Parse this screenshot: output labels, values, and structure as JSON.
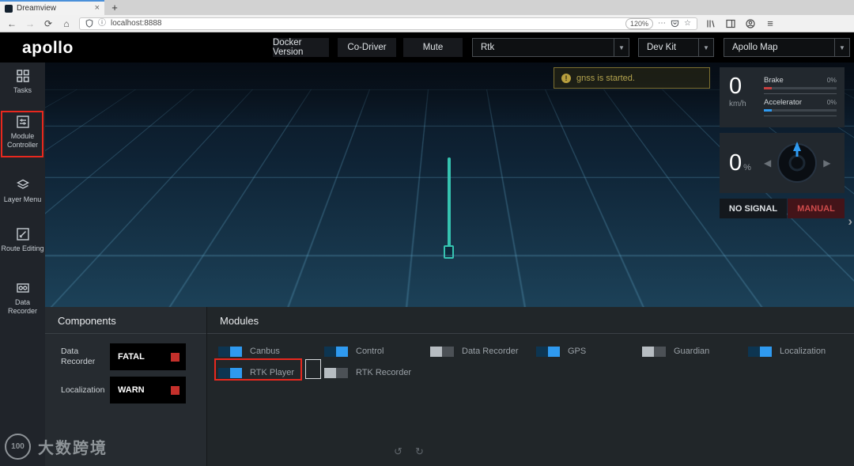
{
  "colors": {
    "accent_blue": "#2f9af0",
    "warn_yellow": "#b3a34e",
    "error_red": "#c4302b",
    "annotation_red": "#e8281e"
  },
  "browser": {
    "tab_title": "Dreamview",
    "close_icon": "×",
    "new_tab_icon": "+",
    "back_icon": "←",
    "forward_icon": "→",
    "reload_icon": "⟳",
    "home_icon": "⌂",
    "info_icon": "ⓘ",
    "url": "localhost:8888",
    "zoom": "120%",
    "overflow_icon": "⋯",
    "star_icon": "☆",
    "menu_icon": "≡"
  },
  "header": {
    "logo": "apollo",
    "buttons": [
      {
        "label": "Docker Version"
      },
      {
        "label": "Co-Driver"
      },
      {
        "label": "Mute"
      }
    ],
    "dropdowns": [
      {
        "label": "Rtk"
      },
      {
        "label": "Dev Kit"
      },
      {
        "label": "Apollo Map"
      }
    ],
    "caret_icon": "▼"
  },
  "sidebar": {
    "items": [
      {
        "label": "Tasks"
      },
      {
        "label": "Module Controller"
      },
      {
        "label": "Layer Menu"
      },
      {
        "label": "Route Editing"
      },
      {
        "label": "Data Recorder"
      }
    ]
  },
  "scene": {
    "notification": {
      "icon": "!",
      "text": "gnss is started."
    },
    "speed": {
      "value": "0",
      "unit": "km/h"
    },
    "pedals": [
      {
        "label": "Brake",
        "value": "0%",
        "color": "#c84040"
      },
      {
        "label": "Accelerator",
        "value": "0%",
        "color": "#2f9af0"
      }
    ],
    "wheel": {
      "value": "0",
      "unit": "%",
      "left_arrow": "◀",
      "right_arrow": "▶"
    },
    "badges": [
      {
        "label": "NO SIGNAL"
      },
      {
        "label": "MANUAL"
      }
    ],
    "expand_chevron": "›",
    "controls": [
      {
        "icon": "↺"
      },
      {
        "icon": "↻"
      }
    ]
  },
  "components_panel": {
    "title": "Components",
    "items": [
      {
        "label": "Data Recorder",
        "status": "FATAL"
      },
      {
        "label": "Localization",
        "status": "WARN"
      }
    ]
  },
  "modules_panel": {
    "title": "Modules",
    "items": [
      {
        "label": "Canbus",
        "on": true
      },
      {
        "label": "Control",
        "on": true
      },
      {
        "label": "Data Recorder",
        "on": false
      },
      {
        "label": "GPS",
        "on": true
      },
      {
        "label": "Guardian",
        "on": false
      },
      {
        "label": "Localization",
        "on": true
      },
      {
        "label": "RTK Player",
        "on": true
      },
      {
        "label": "RTK Recorder",
        "on": false
      }
    ]
  },
  "watermark": {
    "logo_text": "100",
    "text": "大数跨境"
  }
}
